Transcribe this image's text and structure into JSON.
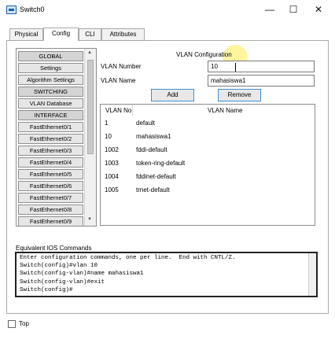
{
  "window": {
    "title": "Switch0",
    "minimize": "—",
    "maximize": "☐",
    "close": "✕"
  },
  "tabs": [
    "Physical",
    "Config",
    "CLI",
    "Attributes"
  ],
  "nav": [
    "GLOBAL",
    "Settings",
    "Algorithm Settings",
    "SWITCHING",
    "VLAN Database",
    "INTERFACE",
    "FastEthernet0/1",
    "FastEthernet0/2",
    "FastEthernet0/3",
    "FastEthernet0/4",
    "FastEthernet0/5",
    "FastEthernet0/6",
    "FastEthernet0/7",
    "FastEthernet0/8",
    "FastEthernet0/9"
  ],
  "vlan": {
    "title": "VLAN Configuration",
    "number_label": "VLAN Number",
    "number_value": "10",
    "name_label": "VLAN Name",
    "name_value": "mahasiswa1",
    "add_button": "Add",
    "remove_button": "Remove",
    "table_headers": [
      "VLAN No",
      "VLAN Name"
    ],
    "rows": [
      {
        "no": "1",
        "name": "default"
      },
      {
        "no": "10",
        "name": "mahasiswa1"
      },
      {
        "no": "1002",
        "name": "fddi-default"
      },
      {
        "no": "1003",
        "name": "token-ring-default"
      },
      {
        "no": "1004",
        "name": "fddinet-default"
      },
      {
        "no": "1005",
        "name": "trnet-default"
      }
    ]
  },
  "ios": {
    "label": "Equivalent IOS Commands",
    "lines": [
      "Enter configuration commands, one per line.  End with CNTL/Z.",
      "Switch(config)#vlan 10",
      "Switch(config-vlan)#name mahasiswa1",
      "Switch(config-vlan)#exit",
      "Switch(config)#"
    ]
  },
  "footer": {
    "top_label": "Top"
  }
}
